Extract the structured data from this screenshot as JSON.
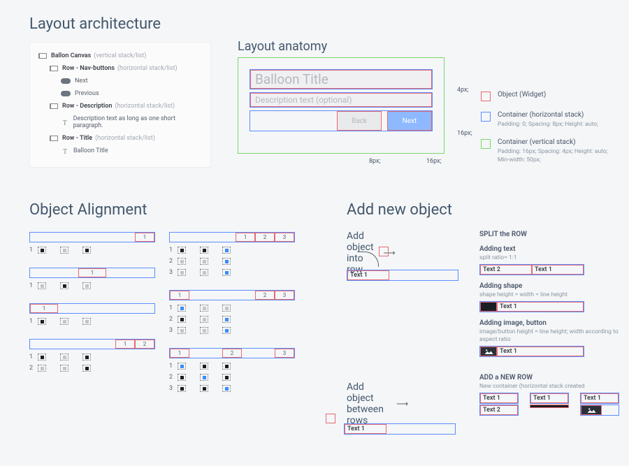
{
  "headings": {
    "layout_architecture": "Layout architecture",
    "layout_anatomy": "Layout anatomy",
    "object_alignment": "Object Alignment",
    "add_new_object": "Add new object"
  },
  "tree": {
    "canvas": {
      "label": "Ballon Canvas",
      "sub": "(vertical stack/list)"
    },
    "row_nav": {
      "label": "Row - Nav-buttons",
      "sub": "(horizontal stack/list)"
    },
    "next": "Next",
    "previous": "Previous",
    "row_desc": {
      "label": "Row - Description",
      "sub": "(horizontal stack/list)"
    },
    "desc_text": "Description text as long as one short paragraph.",
    "row_title": {
      "label": "Row - Title",
      "sub": "(horizontal stack/list)"
    },
    "title_text": "Balloon Title"
  },
  "anatomy": {
    "title_widget": "Balloon Title",
    "desc_widget": "Description text (optional)",
    "back_btn": "Back",
    "next_btn": "Next",
    "dim_4px": "4px;",
    "dim_8px": "8px;",
    "dim_16px_a": "16px;",
    "dim_16px_b": "16px;"
  },
  "legend": {
    "object": {
      "title": "Object (Widget)"
    },
    "container_h": {
      "title": "Container (horizontal stack)",
      "sub": "Padding: 0;   Spacing: 8px;   Height: auto;"
    },
    "container_v": {
      "title": "Container (vertical stack)",
      "sub": "Padding: 16px;   Spacing: 4px;   Height: auto;   Min-width: 50px;"
    }
  },
  "alignment": {
    "cell1": "1",
    "cell2": "2",
    "cell3": "3"
  },
  "addnew": {
    "into_row_title": "Add object into row",
    "between_rows_title": "Add object between rows",
    "text1": "Text 1",
    "text2": "Text 2",
    "split_row": "SPLIT the ROW",
    "adding_text": "Adding text",
    "adding_text_sub": "split ratio= 1:1",
    "adding_shape": "Adding shape",
    "adding_shape_sub": "shape height = width = line height",
    "adding_image": "Adding image, button",
    "adding_image_sub": "image/button height = line height; width according to aspect ratio",
    "add_new_row": "ADD a NEW ROW",
    "new_container": "New container (horizontal stack created"
  },
  "colors": {
    "object_border": "#e86a6f",
    "hstack_border": "#5b8eff",
    "vstack_border": "#7bd66b"
  }
}
